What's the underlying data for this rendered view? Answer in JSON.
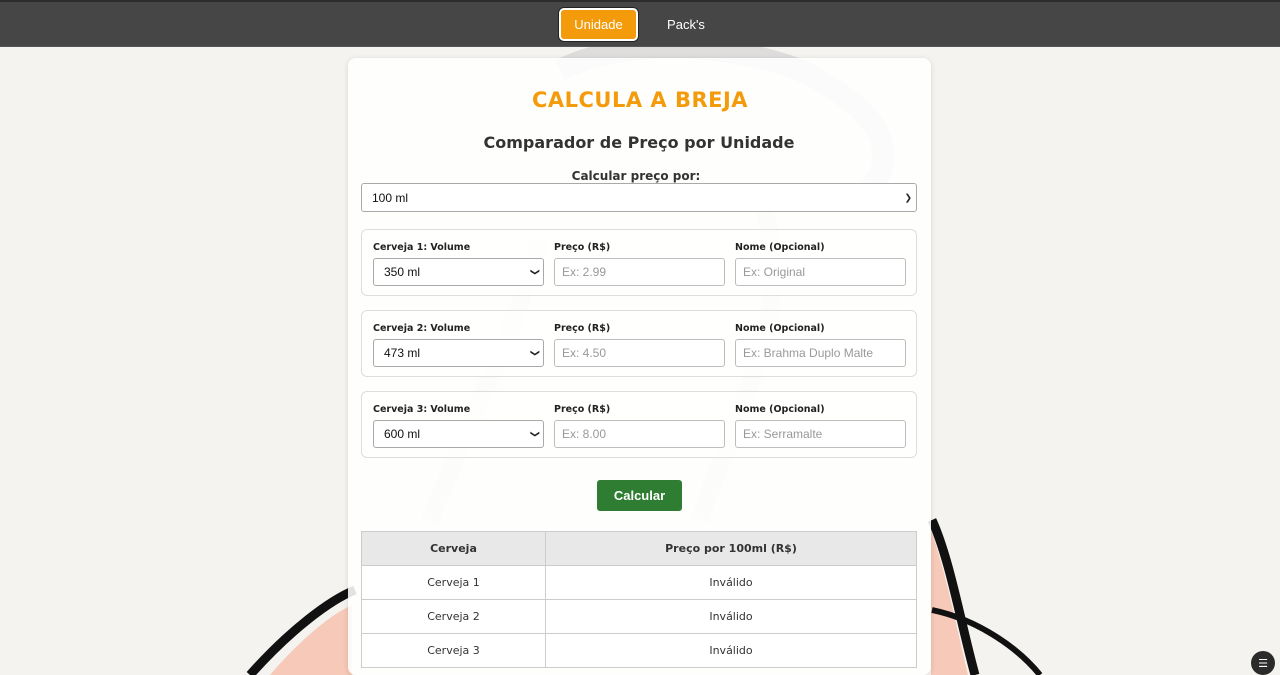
{
  "nav": {
    "tabs": [
      {
        "label": "Unidade",
        "active": true
      },
      {
        "label": "Pack's",
        "active": false
      }
    ]
  },
  "header": {
    "title": "CALCULA A BREJA",
    "subtitle": "Comparador de Preço por Unidade"
  },
  "calc_per": {
    "label": "Calcular preço por:",
    "selected": "100 ml"
  },
  "beers": [
    {
      "volume_label": "Cerveja 1: Volume",
      "volume_value": "350 ml",
      "price_label": "Preço (R$)",
      "price_placeholder": "Ex: 2.99",
      "name_label": "Nome (Opcional)",
      "name_placeholder": "Ex: Original"
    },
    {
      "volume_label": "Cerveja 2: Volume",
      "volume_value": "473 ml",
      "price_label": "Preço (R$)",
      "price_placeholder": "Ex: 4.50",
      "name_label": "Nome (Opcional)",
      "name_placeholder": "Ex: Brahma Duplo Malte"
    },
    {
      "volume_label": "Cerveja 3: Volume",
      "volume_value": "600 ml",
      "price_label": "Preço (R$)",
      "price_placeholder": "Ex: 8.00",
      "name_label": "Nome (Opcional)",
      "name_placeholder": "Ex: Serramalte"
    }
  ],
  "calculate_label": "Calcular",
  "results": {
    "headers": [
      "Cerveja",
      "Preço por 100ml (R$)"
    ],
    "rows": [
      [
        "Cerveja 1",
        "Inválido"
      ],
      [
        "Cerveja 2",
        "Inválido"
      ],
      [
        "Cerveja 3",
        "Inválido"
      ]
    ]
  },
  "colors": {
    "accent": "#f49b0b",
    "button_green": "#2e7d32",
    "topbar": "#464646"
  },
  "icons": {
    "select_arrow": "chevron-down-icon",
    "corner_widget": "settings-icon"
  }
}
